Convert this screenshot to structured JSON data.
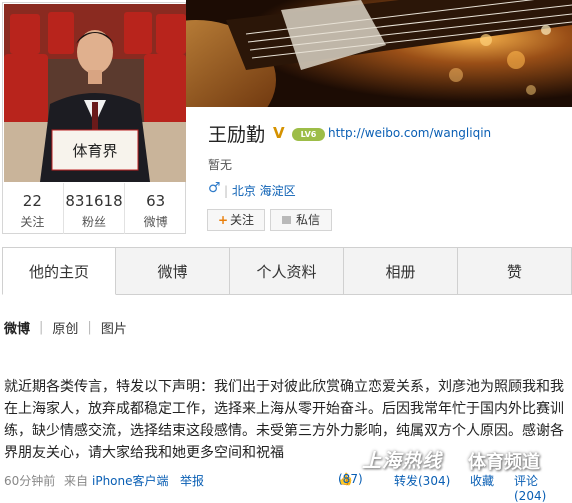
{
  "profile": {
    "name": "王励勤",
    "verified_badge": "V",
    "level_badge": "LV6",
    "weibo_url": "http://weibo.com/wangliqin",
    "bio": "暂无",
    "gender_icon": "♂",
    "location": "北京 海淀区",
    "avatar_sign": "体育界",
    "follow_label": "关注",
    "follow_icon": "+",
    "message_label": "私信"
  },
  "stats": [
    {
      "count": "22",
      "label": "关注"
    },
    {
      "count": "831618",
      "label": "粉丝"
    },
    {
      "count": "63",
      "label": "微博"
    }
  ],
  "tabs": [
    {
      "label": "他的主页"
    },
    {
      "label": "微博"
    },
    {
      "label": "个人资料"
    },
    {
      "label": "相册"
    },
    {
      "label": "赞"
    }
  ],
  "filters": {
    "all": "微博",
    "original": "原创",
    "pictures": "图片",
    "separator": "|"
  },
  "post": {
    "text": "就近期各类传言，特发以下声明：我们出于对彼此欣赏确立恋爱关系，刘彦池为照顾我和我在上海家人，放弃成都稳定工作，选择来上海从零开始奋斗。后因我常年忙于国内外比赛训练，缺少情感交流，选择结束这段感情。未受第三方外力影响，纯属双方个人原因。感谢各界朋友关心，请大家给我和她更多空间和祝福",
    "time": "60分钟前",
    "source_label": "来自",
    "source": "iPhone客户端",
    "report": "举报",
    "likes": "(87)",
    "repost": "转发(304)",
    "favorite": "收藏",
    "comment": "评论(204)"
  },
  "watermark": {
    "main": "上海热线",
    "sub": "体育频道"
  },
  "colors": {
    "link": "#0a5fb4",
    "verified": "#d59200",
    "level": "#9dbd48"
  },
  "icons": {
    "like": "thumbs-up-icon",
    "gender": "male-icon",
    "message": "envelope-icon"
  }
}
